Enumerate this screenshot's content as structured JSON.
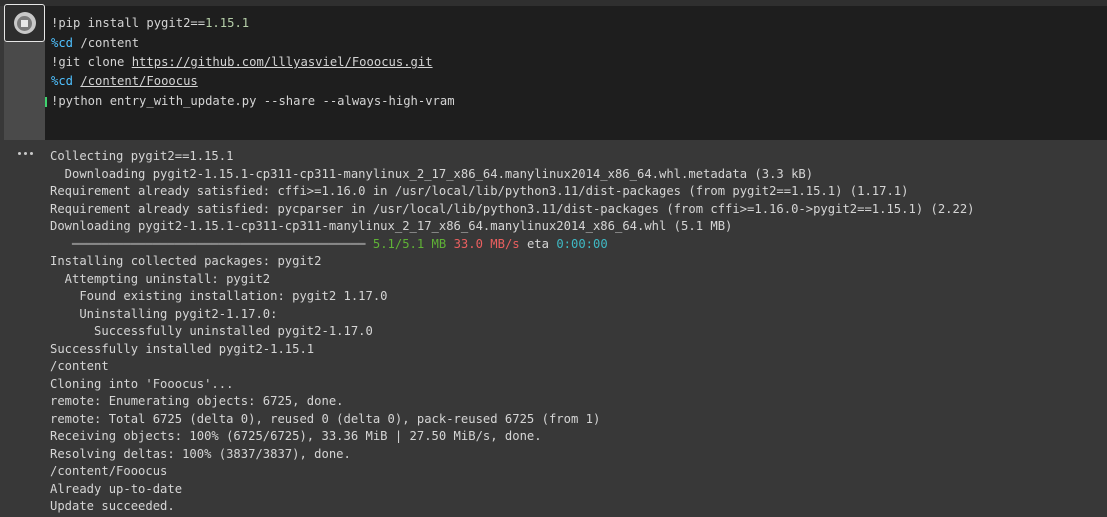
{
  "code_cell": {
    "lines": [
      {
        "prefix": "!pip install pygit2==",
        "num": "1.15.1"
      },
      {
        "magic": "%cd",
        "rest": " /content"
      },
      {
        "prefix": "!git clone ",
        "link": "https://github.com/lllyasviel/Fooocus.git"
      },
      {
        "magic": "%cd",
        "rest": " ",
        "link": "/content/Fooocus"
      },
      {
        "text": "!python entry_with_update.py --share --always-high-vram"
      }
    ]
  },
  "output": {
    "lines": [
      "Collecting pygit2==1.15.1",
      "  Downloading pygit2-1.15.1-cp311-cp311-manylinux_2_17_x86_64.manylinux2014_x86_64.whl.metadata (3.3 kB)",
      "Requirement already satisfied: cffi>=1.16.0 in /usr/local/lib/python3.11/dist-packages (from pygit2==1.15.1) (1.17.1)",
      "Requirement already satisfied: pycparser in /usr/local/lib/python3.11/dist-packages (from cffi>=1.16.0->pygit2==1.15.1) (2.22)",
      "Downloading pygit2-1.15.1-cp311-cp311-manylinux_2_17_x86_64.manylinux2014_x86_64.whl (5.1 MB)",
      null,
      "Installing collected packages: pygit2",
      "  Attempting uninstall: pygit2",
      "    Found existing installation: pygit2 1.17.0",
      "    Uninstalling pygit2-1.17.0:",
      "      Successfully uninstalled pygit2-1.17.0",
      "Successfully installed pygit2-1.15.1",
      "/content",
      "Cloning into 'Fooocus'...",
      "remote: Enumerating objects: 6725, done.",
      "remote: Total 6725 (delta 0), reused 0 (delta 0), pack-reused 6725 (from 1)",
      "Receiving objects: 100% (6725/6725), 33.36 MiB | 27.50 MiB/s, done.",
      "Resolving deltas: 100% (3837/3837), done.",
      "/content/Fooocus",
      "Already up-to-date",
      "Update succeeded."
    ],
    "progress": {
      "size": "5.1/5.1 MB",
      "speed": "33.0 MB/s",
      "eta_label": "eta",
      "eta": "0:00:00",
      "fraction": 1.0
    }
  },
  "icons": {
    "run_button": "stop-run-icon",
    "output_menu": "more-horizontal-icon"
  },
  "colors": {
    "magic": "#4fc1ff",
    "number": "#b5cea8",
    "progress_green": "#5fb236",
    "speed_red": "#ea5f5f",
    "eta_cyan": "#3fb9c4"
  }
}
